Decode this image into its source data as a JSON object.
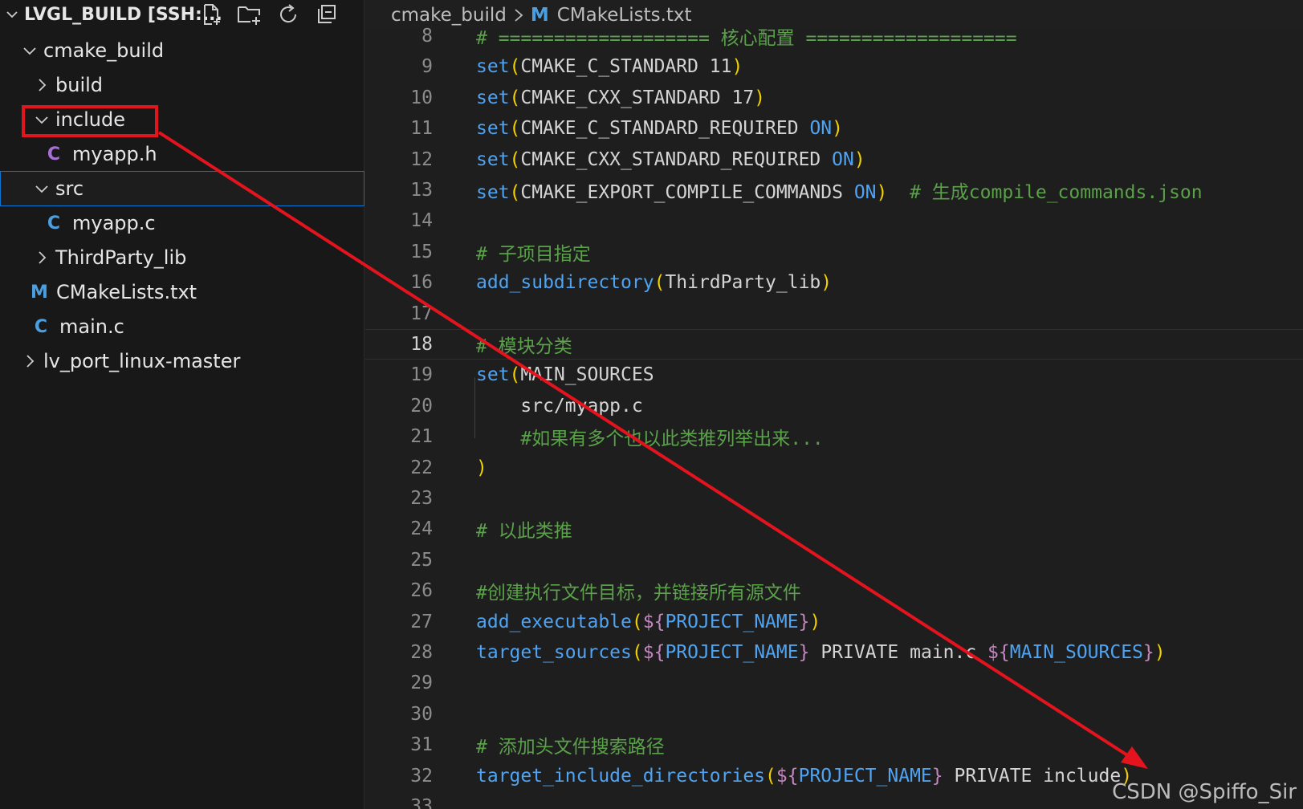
{
  "sidebar": {
    "workspace_title": "LVGL_BUILD [SSH:...",
    "actions": [
      {
        "name": "new-file-icon"
      },
      {
        "name": "new-folder-icon"
      },
      {
        "name": "refresh-icon"
      },
      {
        "name": "collapse-all-icon"
      }
    ],
    "tree": [
      {
        "label": "cmake_build",
        "type": "folder",
        "expanded": true
      },
      {
        "label": "build",
        "type": "folder",
        "expanded": false
      },
      {
        "label": "include",
        "type": "folder",
        "expanded": true
      },
      {
        "label": "myapp.h",
        "type": "file",
        "icon_text": "C",
        "icon_color": "#a86fd6"
      },
      {
        "label": "src",
        "type": "folder",
        "expanded": true,
        "selected": true
      },
      {
        "label": "myapp.c",
        "type": "file",
        "icon_text": "C",
        "icon_color": "#4b9fe0"
      },
      {
        "label": "ThirdParty_lib",
        "type": "folder",
        "expanded": false
      },
      {
        "label": "CMakeLists.txt",
        "type": "file",
        "icon_text": "M",
        "icon_color": "#4b9fe0"
      },
      {
        "label": "main.c",
        "type": "file",
        "icon_text": "C",
        "icon_color": "#4b9fe0"
      },
      {
        "label": "lv_port_linux-master",
        "type": "folder",
        "expanded": false
      }
    ]
  },
  "breadcrumb": {
    "folder": "cmake_build",
    "file_icon": "M",
    "file": "CMakeLists.txt"
  },
  "editor": {
    "lines": [
      {
        "n": "8",
        "tokens": [
          {
            "t": "# =================== 核心配置 ===================",
            "c": "c-cm"
          }
        ]
      },
      {
        "n": "9",
        "tokens": [
          {
            "t": "set",
            "c": "c-fn"
          },
          {
            "t": "(",
            "c": "c-ylw"
          },
          {
            "t": "CMAKE_C_STANDARD 11",
            "c": "c-var"
          },
          {
            "t": ")",
            "c": "c-ylw"
          }
        ]
      },
      {
        "n": "10",
        "tokens": [
          {
            "t": "set",
            "c": "c-fn"
          },
          {
            "t": "(",
            "c": "c-ylw"
          },
          {
            "t": "CMAKE_CXX_STANDARD 17",
            "c": "c-var"
          },
          {
            "t": ")",
            "c": "c-ylw"
          }
        ]
      },
      {
        "n": "11",
        "tokens": [
          {
            "t": "set",
            "c": "c-fn"
          },
          {
            "t": "(",
            "c": "c-ylw"
          },
          {
            "t": "CMAKE_C_STANDARD_REQUIRED ",
            "c": "c-var"
          },
          {
            "t": "ON",
            "c": "c-kw"
          },
          {
            "t": ")",
            "c": "c-ylw"
          }
        ]
      },
      {
        "n": "12",
        "tokens": [
          {
            "t": "set",
            "c": "c-fn"
          },
          {
            "t": "(",
            "c": "c-ylw"
          },
          {
            "t": "CMAKE_CXX_STANDARD_REQUIRED ",
            "c": "c-var"
          },
          {
            "t": "ON",
            "c": "c-kw"
          },
          {
            "t": ")",
            "c": "c-ylw"
          }
        ]
      },
      {
        "n": "13",
        "tokens": [
          {
            "t": "set",
            "c": "c-fn"
          },
          {
            "t": "(",
            "c": "c-ylw"
          },
          {
            "t": "CMAKE_EXPORT_COMPILE_COMMANDS ",
            "c": "c-var"
          },
          {
            "t": "ON",
            "c": "c-kw"
          },
          {
            "t": ")",
            "c": "c-ylw"
          },
          {
            "t": "  # 生成compile_commands.json",
            "c": "c-cm"
          }
        ]
      },
      {
        "n": "14",
        "tokens": []
      },
      {
        "n": "15",
        "tokens": [
          {
            "t": "# 子项目指定",
            "c": "c-cm"
          }
        ]
      },
      {
        "n": "16",
        "tokens": [
          {
            "t": "add_subdirectory",
            "c": "c-fn"
          },
          {
            "t": "(",
            "c": "c-ylw"
          },
          {
            "t": "ThirdParty_lib",
            "c": "c-var"
          },
          {
            "t": ")",
            "c": "c-ylw"
          }
        ]
      },
      {
        "n": "17",
        "tokens": []
      },
      {
        "n": "18",
        "tokens": [
          {
            "t": "# 模块分类",
            "c": "c-cm"
          }
        ],
        "current": true
      },
      {
        "n": "19",
        "tokens": [
          {
            "t": "set",
            "c": "c-fn"
          },
          {
            "t": "(",
            "c": "c-ylw"
          },
          {
            "t": "MAIN_SOURCES",
            "c": "c-var"
          }
        ]
      },
      {
        "n": "20",
        "tokens": [
          {
            "t": "    src/myapp.c",
            "c": "c-var"
          }
        ]
      },
      {
        "n": "21",
        "tokens": [
          {
            "t": "    #如果有多个也以此类推列举出来...",
            "c": "c-cm"
          }
        ]
      },
      {
        "n": "22",
        "tokens": [
          {
            "t": ")",
            "c": "c-ylw"
          }
        ]
      },
      {
        "n": "23",
        "tokens": []
      },
      {
        "n": "24",
        "tokens": [
          {
            "t": "# 以此类推",
            "c": "c-cm"
          }
        ]
      },
      {
        "n": "25",
        "tokens": []
      },
      {
        "n": "26",
        "tokens": [
          {
            "t": "#创建执行文件目标，并链接所有源文件",
            "c": "c-cm"
          }
        ]
      },
      {
        "n": "27",
        "tokens": [
          {
            "t": "add_executable",
            "c": "c-fn"
          },
          {
            "t": "(",
            "c": "c-ylw"
          },
          {
            "t": "${",
            "c": "c-pur"
          },
          {
            "t": "PROJECT_NAME",
            "c": "c-mac"
          },
          {
            "t": "}",
            "c": "c-pur"
          },
          {
            "t": ")",
            "c": "c-ylw"
          }
        ]
      },
      {
        "n": "28",
        "tokens": [
          {
            "t": "target_sources",
            "c": "c-fn"
          },
          {
            "t": "(",
            "c": "c-ylw"
          },
          {
            "t": "${",
            "c": "c-pur"
          },
          {
            "t": "PROJECT_NAME",
            "c": "c-mac"
          },
          {
            "t": "}",
            "c": "c-pur"
          },
          {
            "t": " PRIVATE main.c ",
            "c": "c-var"
          },
          {
            "t": "${",
            "c": "c-pur"
          },
          {
            "t": "MAIN_SOURCES",
            "c": "c-mac"
          },
          {
            "t": "}",
            "c": "c-pur"
          },
          {
            "t": ")",
            "c": "c-ylw"
          }
        ]
      },
      {
        "n": "29",
        "tokens": []
      },
      {
        "n": "30",
        "tokens": []
      },
      {
        "n": "31",
        "tokens": [
          {
            "t": "# 添加头文件搜索路径",
            "c": "c-cm"
          }
        ]
      },
      {
        "n": "32",
        "tokens": [
          {
            "t": "target_include_directories",
            "c": "c-fn"
          },
          {
            "t": "(",
            "c": "c-ylw"
          },
          {
            "t": "${",
            "c": "c-pur"
          },
          {
            "t": "PROJECT_NAME",
            "c": "c-mac"
          },
          {
            "t": "}",
            "c": "c-pur"
          },
          {
            "t": " PRIVATE include",
            "c": "c-var"
          },
          {
            "t": ")",
            "c": "c-ylw"
          }
        ]
      },
      {
        "n": "33",
        "tokens": []
      }
    ]
  },
  "annotation": {
    "color": "#e3141e"
  },
  "watermark": "CSDN @Spiffo_Sir"
}
